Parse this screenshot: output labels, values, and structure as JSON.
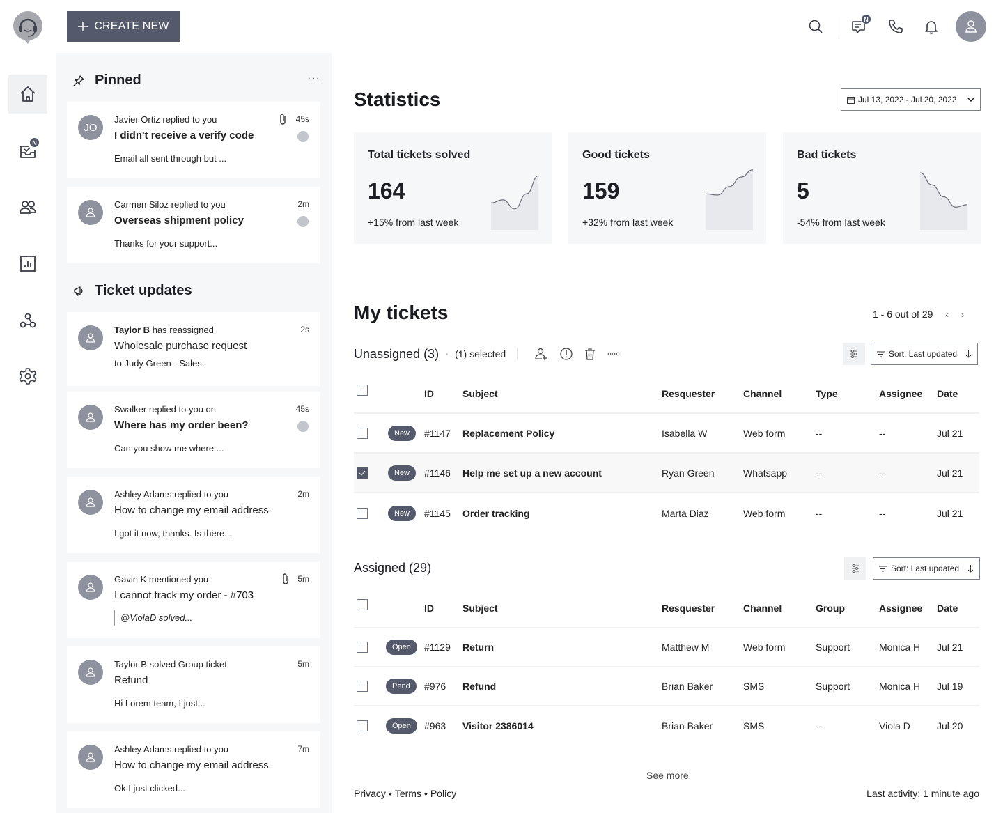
{
  "header": {
    "create_label": "CREATE NEW",
    "nav_badge": "N",
    "messages_badge": "N"
  },
  "icons": {
    "logo": "headset-support-icon",
    "nav": [
      "home-icon",
      "inbox-tasks-icon",
      "users-icon",
      "reports-icon",
      "integrations-icon",
      "settings-icon"
    ],
    "header": [
      "search-icon",
      "messages-icon",
      "phone-icon",
      "bell-icon",
      "user-avatar-icon"
    ]
  },
  "feed": {
    "pinned_title": "Pinned",
    "updates_title": "Ticket updates",
    "more_label": "···",
    "pinned": [
      {
        "initials": "JO",
        "actor": "Javier Ortiz",
        "action": "replied to you",
        "title": "I didn't receive a verify code",
        "preview": "Email all sent through but ...",
        "time": "45s",
        "attachment": true,
        "unread": true,
        "title_bold": true
      },
      {
        "initials": "",
        "actor": "Carmen Siloz",
        "action": "replied to you",
        "title": "Overseas shipment policy",
        "preview": "Thanks for your support...",
        "time": "2m",
        "attachment": false,
        "unread": true,
        "title_bold": true
      }
    ],
    "updates": [
      {
        "actor": "Taylor B",
        "action": "has reassigned",
        "title": "Wholesale purchase request",
        "preview_prefix": "to ",
        "preview": "Judy Green - Sales.",
        "time": "2s",
        "attachment": false,
        "unread": false,
        "title_bold": false
      },
      {
        "actor": "Swalker",
        "action": "replied to you on",
        "title": "Where has my order been?",
        "preview": "Can you show me where ...",
        "time": "45s",
        "attachment": false,
        "unread": true,
        "title_bold": true
      },
      {
        "actor": "Ashley Adams",
        "action": "replied to you",
        "title": "How to change my email address",
        "preview": "I got it now, thanks. Is there...",
        "time": "2m",
        "attachment": false,
        "unread": false,
        "title_bold": false
      },
      {
        "actor": "Gavin K",
        "action": "mentioned you",
        "title": "I cannot track my order - #703",
        "preview": "@ViolaD solved...",
        "time": "5m",
        "attachment": true,
        "unread": false,
        "title_bold": false,
        "quote": true
      },
      {
        "actor": "Taylor B",
        "action": "solved Group ticket",
        "title": "Refund",
        "preview": "Hi Lorem team, I just...",
        "time": "5m",
        "attachment": false,
        "unread": false,
        "title_bold": false
      },
      {
        "actor": "Ashley Adams",
        "action": "replied to you",
        "title": "How to change my email address",
        "preview": "Ok I just clicked...",
        "time": "7m",
        "attachment": false,
        "unread": false,
        "title_bold": false
      }
    ]
  },
  "statistics": {
    "title": "Statistics",
    "date_range": "Jul 13, 2022 - Jul 20, 2022",
    "cards": [
      {
        "label": "Total tickets solved",
        "value": "164",
        "change": "+15% from last week",
        "trend": [
          0.45,
          0.5,
          0.35,
          0.6,
          0.9
        ]
      },
      {
        "label": "Good tickets",
        "value": "159",
        "change": "+32% from last week",
        "trend": [
          0.6,
          0.58,
          0.72,
          0.88,
          1.0
        ]
      },
      {
        "label": "Bad tickets",
        "value": "5",
        "change": "-54% from last week",
        "trend": [
          0.95,
          0.75,
          0.55,
          0.38,
          0.42
        ]
      }
    ]
  },
  "tickets": {
    "title": "My tickets",
    "pagination": "1 - 6 out of 29",
    "sort_label": "Sort: Last updated",
    "unassigned": {
      "title": "Unassigned (3)",
      "selected": "(1) selected",
      "columns": [
        "ID",
        "Subject",
        "Resquester",
        "Channel",
        "Type",
        "Assignee",
        "Date"
      ],
      "rows": [
        {
          "checked": false,
          "status": "New",
          "id": "#1147",
          "subject": "Replacement Policy",
          "requester": "Isabella W",
          "channel": "Web form",
          "type": "--",
          "assignee": "--",
          "date": "Jul 21"
        },
        {
          "checked": true,
          "status": "New",
          "id": "#1146",
          "subject": "Help me set up a new account",
          "requester": "Ryan Green",
          "channel": "Whatsapp",
          "type": "--",
          "assignee": "--",
          "date": "Jul 21"
        },
        {
          "checked": false,
          "status": "New",
          "id": "#1145",
          "subject": "Order tracking",
          "requester": "Marta Diaz",
          "channel": "Web form",
          "type": "--",
          "assignee": "--",
          "date": "Jul 21"
        }
      ]
    },
    "assigned": {
      "title": "Assigned (29)",
      "columns": [
        "ID",
        "Subject",
        "Resquester",
        "Channel",
        "Group",
        "Assignee",
        "Date"
      ],
      "rows": [
        {
          "checked": false,
          "status": "Open",
          "id": "#1129",
          "subject": "Return",
          "requester": "Matthew M",
          "channel": "Web form",
          "type": "Support",
          "assignee": "Monica H",
          "date": "Jul 21"
        },
        {
          "checked": false,
          "status": "Pend",
          "id": "#976",
          "subject": "Refund",
          "requester": "Brian Baker",
          "channel": "SMS",
          "type": "Support",
          "assignee": "Monica H",
          "date": "Jul 19"
        },
        {
          "checked": false,
          "status": "Open",
          "id": "#963",
          "subject": "Visitor 2386014",
          "requester": "Brian Baker",
          "channel": "SMS",
          "type": "--",
          "assignee": "Viola D",
          "date": "Jul 20"
        }
      ]
    },
    "see_more": "See more"
  },
  "footer": {
    "links": [
      "Privacy",
      "Terms",
      "Policy"
    ],
    "separator": "•",
    "last_activity": "Last activity: 1 minute ago"
  },
  "colors": {
    "primary": "#545a6b",
    "panel_bg": "#f6f7f9",
    "avatar": "#8e929e",
    "unread_dot": "#c2c5cc"
  }
}
